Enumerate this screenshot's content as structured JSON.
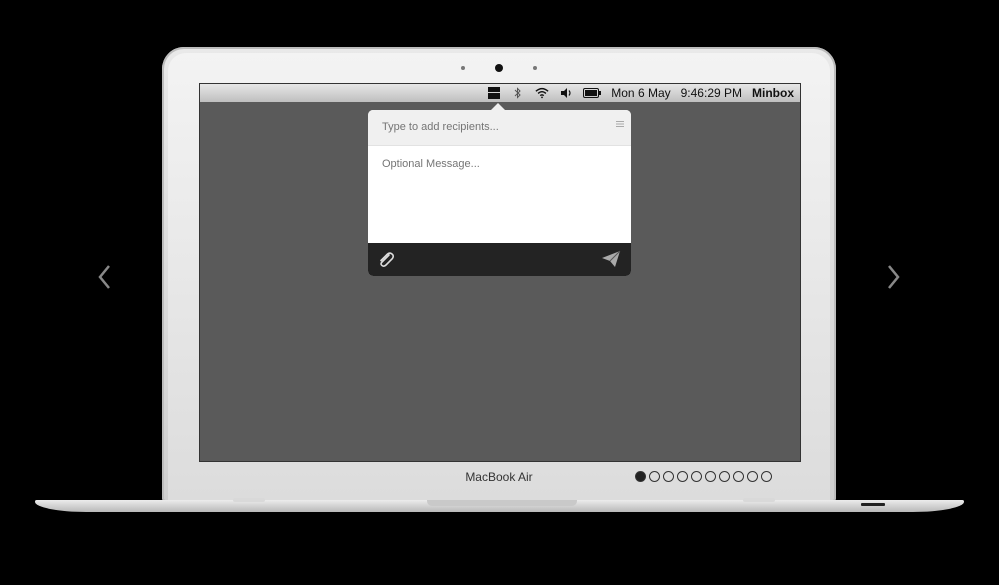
{
  "menubar": {
    "icons": [
      "minbox-icon",
      "bluetooth-icon",
      "wifi-icon",
      "volume-icon",
      "battery-icon"
    ],
    "date": "Mon 6 May",
    "time": "9:46:29 PM",
    "app_name": "Minbox"
  },
  "popover": {
    "recipients_placeholder": "Type to add recipients...",
    "message_placeholder": "Optional Message...",
    "attach_icon": "paperclip-icon",
    "send_icon": "paper-plane-icon",
    "menu_icon": "menu-icon"
  },
  "device": {
    "brand_label": "MacBook Air"
  },
  "carousel": {
    "total": 10,
    "active_index": 0,
    "prev_icon": "chevron-left-icon",
    "next_icon": "chevron-right-icon"
  },
  "colors": {
    "background": "#000000",
    "screen": "#5a5a5a",
    "popover_footer": "#232323"
  }
}
